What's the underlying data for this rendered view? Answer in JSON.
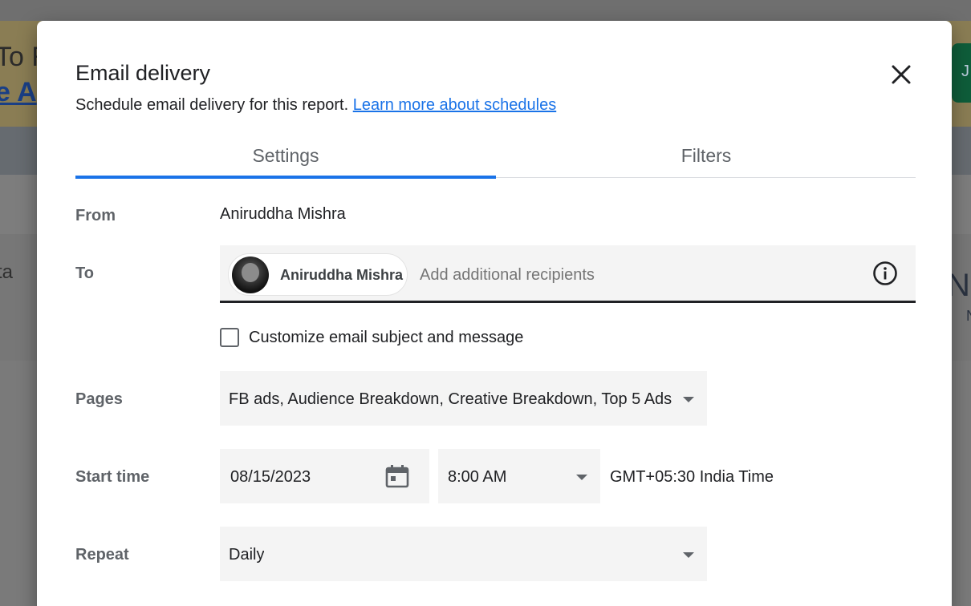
{
  "background": {
    "banner_text_1": "To R",
    "banner_text_2": "e A",
    "left_text": "ta",
    "right_text": "No",
    "right_small": "N",
    "right_button": "J"
  },
  "dialog": {
    "title": "Email delivery",
    "subtitle": "Schedule email delivery for this report.",
    "learn_more_link": "Learn more about schedules",
    "close_icon": "close-icon"
  },
  "tabs": [
    {
      "label": "Settings",
      "active": true
    },
    {
      "label": "Filters",
      "active": false
    }
  ],
  "form": {
    "from": {
      "label": "From",
      "value": "Aniruddha Mishra"
    },
    "to": {
      "label": "To",
      "recipient_chip": "Aniruddha Mishra",
      "placeholder": "Add additional recipients",
      "info_icon": "info-icon"
    },
    "customize": {
      "label": "Customize email subject and message",
      "checked": false
    },
    "pages": {
      "label": "Pages",
      "value": "FB ads, Audience Breakdown, Creative Breakdown, Top 5 Ads"
    },
    "start_time": {
      "label": "Start time",
      "date": "08/15/2023",
      "calendar_icon": "calendar-icon",
      "time": "8:00 AM",
      "timezone": "GMT+05:30 India Time"
    },
    "repeat": {
      "label": "Repeat",
      "value": "Daily"
    }
  },
  "colors": {
    "accent": "#1a73e8",
    "field_bg": "#f4f4f4",
    "label_gray": "#5f6368"
  }
}
